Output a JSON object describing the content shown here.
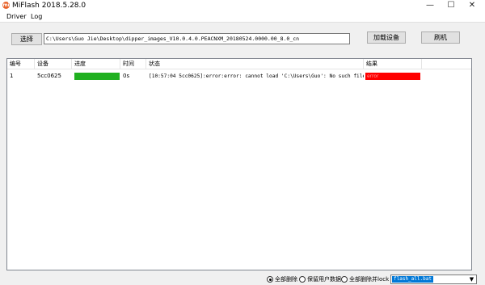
{
  "window": {
    "title": "MiFlash 2018.5.28.0",
    "app_icon": "mi-logo-icon"
  },
  "menu": {
    "items": [
      "Driver",
      "Log"
    ]
  },
  "toolbar": {
    "select_label": "选择",
    "path_value": "C:\\Users\\Guo Jie\\Desktop\\dipper_images_V10.0.4.0.PEACNXM_20180524.0000.00_8.0_cn",
    "load_device_label": "加载设备",
    "refresh_label": "刷机"
  },
  "table": {
    "columns": [
      "编号",
      "设备",
      "进度",
      "时间",
      "状态",
      "结果"
    ],
    "rows": [
      {
        "id": "1",
        "device": "5cc0625",
        "progress_percent": 100,
        "time": "0s",
        "status": "[10:57:04 5cc0625]:error:error: cannot load 'C:\\Users\\Guo': No such file or ...",
        "result": "error"
      }
    ]
  },
  "options": {
    "radios": [
      "全部删除",
      "保留用户数据",
      "全部删除并lock"
    ],
    "selected_index": 0,
    "script_value": "flash_all.bat"
  },
  "colors": {
    "progress": "#20b020",
    "result_error": "#ff0000",
    "selection": "#0078d7"
  }
}
